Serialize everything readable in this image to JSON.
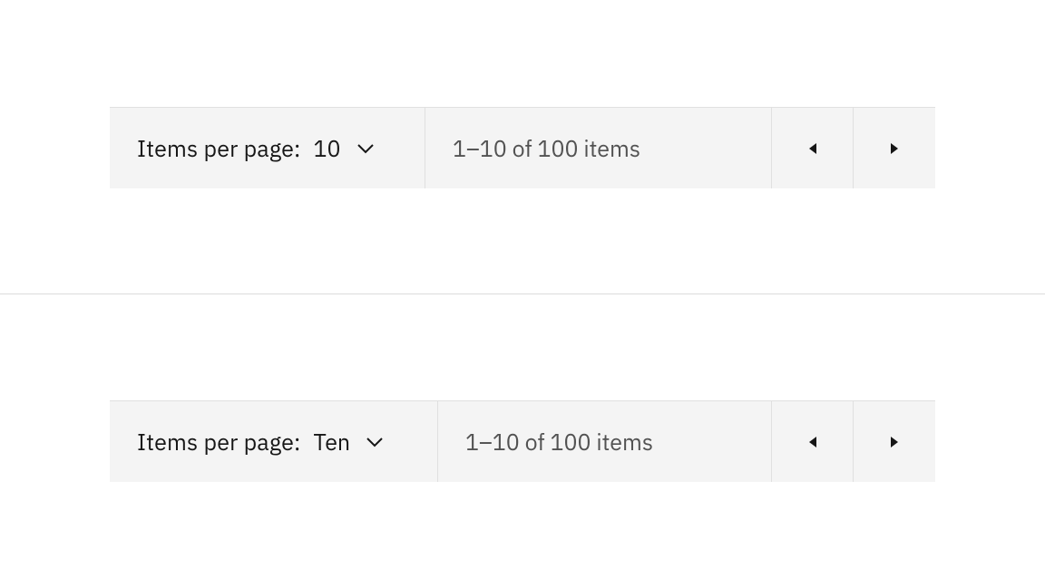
{
  "colors": {
    "bg_bar": "#f4f4f4",
    "border": "#e0e0e0",
    "text_primary": "#161616",
    "text_secondary": "#525252",
    "divider": "#dcdcdc"
  },
  "paginations": [
    {
      "items_per_page_label": "Items per page:",
      "page_size_value": "10",
      "range_text": "1–10 of 100 items"
    },
    {
      "items_per_page_label": "Items per page:",
      "page_size_value": "Ten",
      "range_text": "1–10 of 100 items"
    }
  ]
}
